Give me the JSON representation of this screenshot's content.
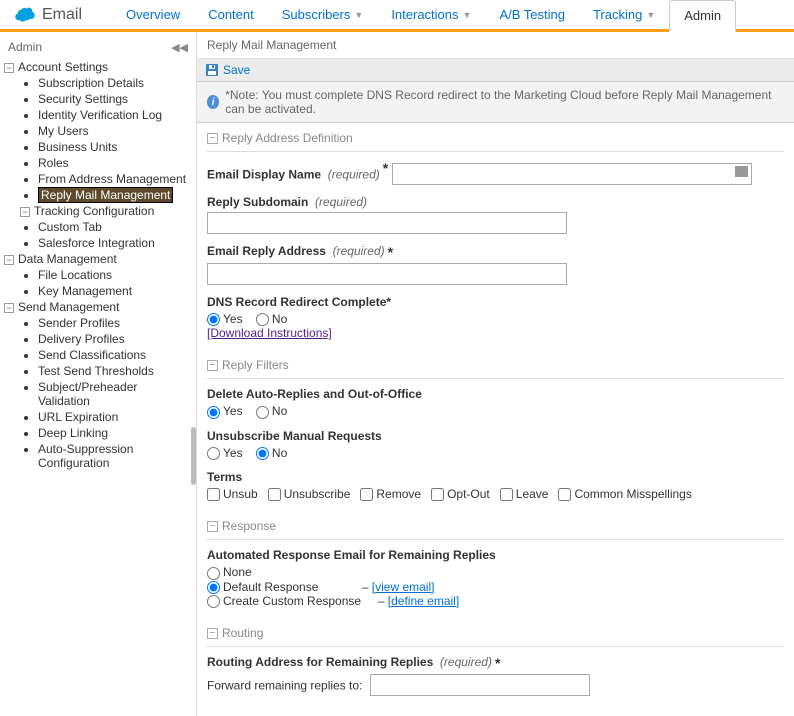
{
  "app_title": "Email",
  "tabs": [
    "Overview",
    "Content",
    "Subscribers",
    "Interactions",
    "A/B Testing",
    "Tracking",
    "Admin"
  ],
  "tabs_with_caret": [
    false,
    false,
    true,
    true,
    false,
    true,
    false
  ],
  "active_tab": 6,
  "sidebar": {
    "title": "Admin",
    "groups": [
      {
        "label": "Account Settings",
        "items": [
          "Subscription Details",
          "Security Settings",
          "Identity Verification Log",
          "My Users",
          "Business Units",
          "Roles",
          "From Address Management",
          "Reply Mail Management"
        ],
        "subgroup": {
          "label": "Tracking Configuration",
          "items": [
            "Custom Tab"
          ]
        },
        "trailing": [
          "Salesforce Integration"
        ]
      },
      {
        "label": "Data Management",
        "items": [
          "File Locations",
          "Key Management"
        ]
      },
      {
        "label": "Send Management",
        "items": [
          "Sender Profiles",
          "Delivery Profiles",
          "Send Classifications",
          "Test Send Thresholds",
          "Subject/Preheader Validation",
          "URL Expiration",
          "Deep Linking",
          "Auto-Suppression Configuration"
        ]
      }
    ],
    "selected": "Reply Mail Management"
  },
  "page": {
    "title": "Reply Mail Management",
    "save_label": "Save",
    "notice": "*Note: You must complete DNS Record redirect to the Marketing Cloud before Reply Mail Management can be activated.",
    "sections": {
      "reply_address": {
        "title": "Reply Address Definition",
        "email_display_name": {
          "label": "Email Display Name",
          "required": "(required)",
          "value": ""
        },
        "reply_subdomain": {
          "label": "Reply Subdomain",
          "required": "(required)",
          "value": ""
        },
        "email_reply_address": {
          "label": "Email Reply Address",
          "required": "(required)",
          "value": ""
        },
        "dns_redirect": {
          "label": "DNS Record Redirect Complete*",
          "yes": "Yes",
          "no": "No",
          "selected": "yes",
          "download_link": "[Download Instructions]"
        }
      },
      "reply_filters": {
        "title": "Reply Filters",
        "delete_auto": {
          "label": "Delete Auto-Replies and Out-of-Office",
          "yes": "Yes",
          "no": "No",
          "selected": "yes"
        },
        "unsub_manual": {
          "label": "Unsubscribe Manual Requests",
          "yes": "Yes",
          "no": "No",
          "selected": "no"
        },
        "terms": {
          "label": "Terms",
          "options": [
            "Unsub",
            "Unsubscribe",
            "Remove",
            "Opt-Out",
            "Leave",
            "Common Misspellings"
          ]
        }
      },
      "response": {
        "title": "Response",
        "label": "Automated Response Email for Remaining Replies",
        "none": "None",
        "default": "Default Response",
        "custom": "Create Custom Response",
        "selected": "default",
        "view_email": "[view email]",
        "define_email": "[define email]",
        "dash": "–"
      },
      "routing": {
        "title": "Routing",
        "label": "Routing Address for Remaining Replies",
        "required": "(required)",
        "forward_label": "Forward remaining replies to:",
        "value": ""
      }
    }
  }
}
